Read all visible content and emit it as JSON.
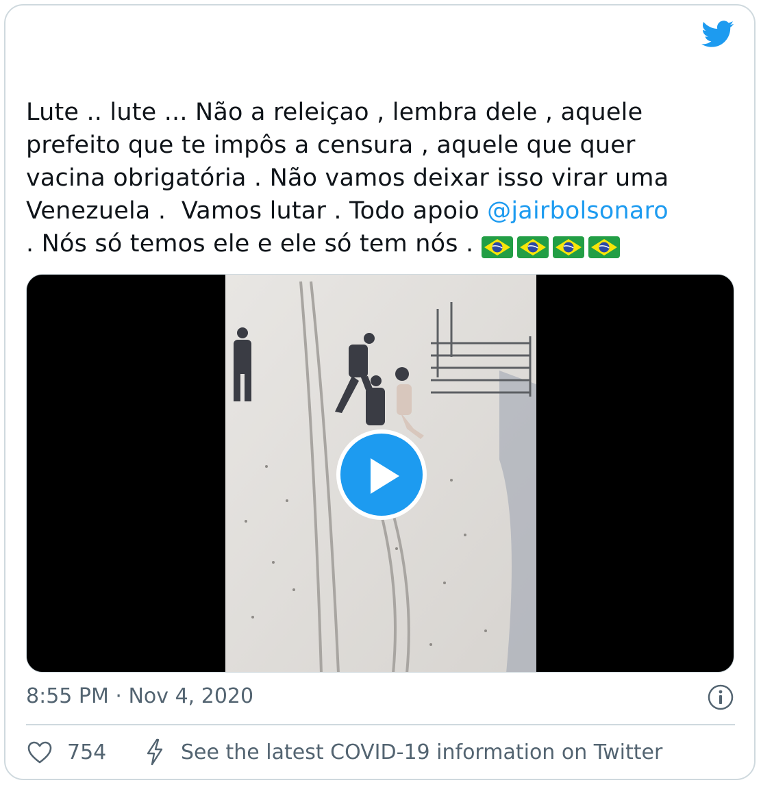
{
  "tweet": {
    "lines": [
      "Lute .. lute ... Não a releiçao , lembra dele , aquele",
      "prefeito que te impôs a censura , aquele que quer",
      "vacina obrigatória . Não vamos deixar isso virar uma",
      "Venezuela .  Vamos lutar . Todo apoio "
    ],
    "mention": "@jairbolsonaro",
    "last_line": ". Nós só temos ele e ele só tem nós . ",
    "flag_emoji_count": 4
  },
  "timestamp": "8:55 PM · Nov 4, 2020",
  "likes": "754",
  "covid_link": "See the latest COVID-19 information on Twitter",
  "colors": {
    "twitter_blue": "#1d9bf0",
    "text": "#0f1419",
    "muted": "#536471",
    "border": "#cfd9de"
  },
  "icons": [
    "twitter-bird-icon",
    "play-icon",
    "info-icon",
    "heart-icon",
    "bolt-icon",
    "brazil-flag-icon"
  ]
}
